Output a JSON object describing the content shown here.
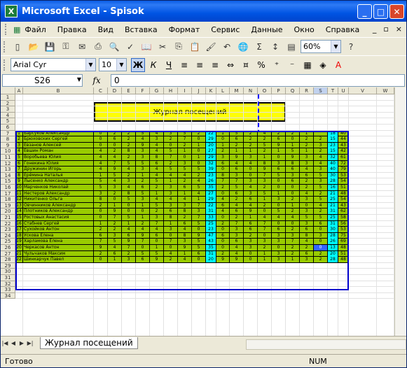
{
  "window": {
    "title": "Microsoft Excel - Spisok",
    "app_icon": "X"
  },
  "menu": {
    "items": [
      "Файл",
      "Правка",
      "Вид",
      "Вставка",
      "Формат",
      "Сервис",
      "Данные",
      "Окно",
      "Справка"
    ]
  },
  "toolbar": {
    "zoom": "60%"
  },
  "format_bar": {
    "font": "Arial Cyr",
    "size": "10",
    "bold": "Ж",
    "italic": "К",
    "underline": "Ч"
  },
  "formula_bar": {
    "cell": "S26",
    "fx": "fx",
    "value": "0"
  },
  "columns": [
    "A",
    "B",
    "C",
    "D",
    "E",
    "F",
    "G",
    "H",
    "I",
    "J",
    "K",
    "L",
    "M",
    "N",
    "O",
    "P",
    "Q",
    "R",
    "S",
    "T",
    "U",
    "V",
    "W"
  ],
  "rows": [
    "1",
    "2",
    "3",
    "4",
    "5",
    "6",
    "7",
    "8",
    "9",
    "10",
    "11",
    "12",
    "13",
    "14",
    "15",
    "16",
    "17",
    "18",
    "19",
    "20",
    "21",
    "22",
    "23",
    "24",
    "25",
    "26",
    "27",
    "28",
    "29",
    "30",
    "31",
    "32",
    "33",
    "34"
  ],
  "sheet": {
    "banner": "Журнал посещений",
    "header_name": "Фамилия, имя",
    "dates_sep": [
      "01 сен",
      "05 сен",
      "08 сен",
      "10 сен",
      "12 сен",
      "15 сен",
      "20 сен",
      "26 сен"
    ],
    "total_sep": "Всего",
    "dates_oct": [
      "02 окт",
      "05 окт",
      "07 окт",
      "13 окт",
      "17 окт",
      "23 окт",
      "29 окт",
      "30 окт"
    ],
    "total_oct": "Всего",
    "total_all": "Итог",
    "students": [
      {
        "n": "1",
        "name": "Барсуков Александр",
        "sep": [
          "0",
          "2",
          "2",
          "5",
          "4",
          "3",
          "5",
          "2"
        ],
        "st": "22",
        "oct": [
          "1",
          "5",
          "2",
          "4",
          "2",
          "2",
          "1",
          ""
        ],
        "ot": "18",
        "t": "40"
      },
      {
        "n": "2",
        "name": "Брюховских Сергей",
        "sep": [
          "0",
          "6",
          "2",
          "4",
          "3",
          "2",
          "7",
          "0"
        ],
        "st": "29",
        "oct": [
          "0",
          "6",
          "2",
          "2",
          "6",
          "0",
          "2",
          "2"
        ],
        "ot": "15",
        "t": "44"
      },
      {
        "n": "3",
        "name": "Евзанов Алексей",
        "sep": [
          "0",
          "0",
          "2",
          "9",
          "4",
          "0",
          "2",
          "1"
        ],
        "st": "20",
        "oct": [
          "1",
          "2",
          "2",
          "5",
          "9",
          "1",
          "2",
          "3"
        ],
        "ot": "23",
        "t": "43"
      },
      {
        "n": "4",
        "name": "Евшин Роман",
        "sep": [
          "4",
          "2",
          "8",
          "3",
          "4",
          "5",
          "1",
          "0"
        ],
        "st": "27",
        "oct": [
          "2",
          "1",
          "1",
          "2",
          "1",
          "5",
          "1",
          "2"
        ],
        "ot": "15",
        "t": "42"
      },
      {
        "n": "5",
        "name": "Воробьева Юлия",
        "sep": [
          "4",
          "4",
          "2",
          "3",
          "8",
          "7",
          "0",
          "1"
        ],
        "st": "29",
        "oct": [
          "3",
          "9",
          "3",
          "1",
          "0",
          "9",
          "3",
          "4"
        ],
        "ot": "32",
        "t": "61"
      },
      {
        "n": "6",
        "name": "Гонекина Юлия",
        "sep": [
          "4",
          "7",
          "5",
          "5",
          "6",
          "2",
          "3",
          "0"
        ],
        "st": "32",
        "oct": [
          "6",
          "4",
          "4",
          "8",
          "3",
          "8",
          "3",
          "4"
        ],
        "ot": "40",
        "t": "72"
      },
      {
        "n": "7",
        "name": "Дружинин Игорь",
        "sep": [
          "4",
          "9",
          "4",
          "3",
          "4",
          "5",
          "5",
          "5"
        ],
        "st": "39",
        "oct": [
          "0",
          "6",
          "0",
          "9",
          "6",
          "6",
          "4",
          "3"
        ],
        "ot": "40",
        "t": "79"
      },
      {
        "n": "8",
        "name": "Ерёмина Наталья",
        "sep": [
          "1",
          "5",
          "2",
          "1",
          "4",
          "4",
          "4",
          "2"
        ],
        "st": "23",
        "oct": [
          "8",
          "3",
          "0",
          "7",
          "5",
          "3",
          "6",
          "5"
        ],
        "ot": "30",
        "t": "53"
      },
      {
        "n": "9",
        "name": "Лысенко Александр",
        "sep": [
          "5",
          "4",
          "3",
          "2",
          "5",
          "1",
          "2",
          "4"
        ],
        "st": "26",
        "oct": [
          "7",
          "7",
          "3",
          "3",
          "0",
          "6",
          "2",
          "3"
        ],
        "ot": "28",
        "t": "54"
      },
      {
        "n": "10",
        "name": "Марченков Николай",
        "sep": [
          "5",
          "3",
          "4",
          "6",
          "2",
          "3",
          "6",
          "5"
        ],
        "st": "35",
        "oct": [
          "2",
          "5",
          "4",
          "2",
          "0",
          "0",
          "2",
          "5"
        ],
        "ot": "16",
        "t": "51"
      },
      {
        "n": "11",
        "name": "Нестеров Александр",
        "sep": [
          "3",
          "2",
          "8",
          "5",
          "1",
          "3",
          "1",
          "4"
        ],
        "st": "27",
        "oct": [
          "0",
          "6",
          "3",
          "5",
          "1",
          "0",
          "4",
          "2"
        ],
        "ot": "21",
        "t": "48"
      },
      {
        "n": "12",
        "name": "Никитенко Ольга",
        "sep": [
          "8",
          "0",
          "5",
          "3",
          "4",
          "4",
          "4",
          "1"
        ],
        "st": "29",
        "oct": [
          "4",
          "2",
          "6",
          "1",
          "3",
          "2",
          "3",
          "5"
        ],
        "ot": "25",
        "t": "54"
      },
      {
        "n": "13",
        "name": "Овчинников Александр",
        "sep": [
          "2",
          "1",
          "0",
          "1",
          "5",
          "3",
          "3",
          "7"
        ],
        "st": "22",
        "oct": [
          "6",
          "4",
          "4",
          "2",
          "0",
          "1",
          "0",
          "4"
        ],
        "ot": "21",
        "t": "43"
      },
      {
        "n": "14",
        "name": "Плотников Александр",
        "sep": [
          "0",
          "9",
          "0",
          "0",
          "2",
          "6",
          "8",
          "3"
        ],
        "st": "31",
        "oct": [
          "4",
          "6",
          "9",
          "0",
          "5",
          "2",
          "3",
          "2"
        ],
        "ot": "31",
        "t": "62"
      },
      {
        "n": "15",
        "name": "Ростовых Анастасия",
        "sep": [
          "0",
          "7",
          "5",
          "1",
          "3",
          "8",
          "2",
          "7"
        ],
        "st": "33",
        "oct": [
          "0",
          "2",
          "1",
          "4",
          "4",
          "4",
          "5",
          "5"
        ],
        "ot": "25",
        "t": "58"
      },
      {
        "n": "16",
        "name": "Стабнев Сергей",
        "sep": [
          "1",
          "2",
          "1",
          "2",
          "7",
          "1",
          "6",
          "5"
        ],
        "st": "25",
        "oct": [
          "2",
          "7",
          "6",
          "7",
          "0",
          "0",
          "3",
          "6"
        ],
        "ot": "31",
        "t": "56"
      },
      {
        "n": "17",
        "name": "Сухойков Антон",
        "sep": [
          "2",
          "2",
          "4",
          "4",
          "4",
          "3",
          "4",
          "0"
        ],
        "st": "23",
        "oct": [
          "0",
          "3",
          "6",
          "7",
          "6",
          "2",
          "6",
          "0"
        ],
        "ot": "30",
        "t": "53"
      },
      {
        "n": "18",
        "name": "Ускова Елена",
        "sep": [
          "6",
          "3",
          "6",
          "9",
          "6",
          "0",
          "8",
          "9"
        ],
        "st": "47",
        "oct": [
          "6",
          "3",
          "2",
          "0",
          "3",
          "3",
          "8",
          "3"
        ],
        "ot": "28",
        "t": "75"
      },
      {
        "n": "19",
        "name": "Харламова Елена",
        "sep": [
          "7",
          "5",
          "9",
          "7",
          "0",
          "7",
          "3",
          "5"
        ],
        "st": "43",
        "oct": [
          "0",
          "6",
          "3",
          "3",
          "3",
          "7",
          "4",
          "0"
        ],
        "ot": "26",
        "t": "69"
      },
      {
        "n": "20",
        "name": "Черкасов Антон",
        "sep": [
          "9",
          "4",
          "7",
          "0",
          "1",
          "0",
          "9",
          "5"
        ],
        "st": "35",
        "oct": [
          "0",
          "4",
          "3",
          "2",
          "0",
          "2",
          "2",
          "0"
        ],
        "ot": "13",
        "t": "48"
      },
      {
        "n": "21",
        "name": "Чульчаков Максим",
        "sep": [
          "2",
          "6",
          "2",
          "5",
          "5",
          "4",
          "1",
          "6"
        ],
        "st": "31",
        "oct": [
          "2",
          "4",
          "0",
          "1",
          "3",
          "2",
          "6",
          "2"
        ],
        "ot": "20",
        "t": "51"
      },
      {
        "n": "22",
        "name": "Шинкарчук Павел",
        "sep": [
          "0",
          "1",
          "3",
          "6",
          "9",
          "2",
          "4",
          "0"
        ],
        "st": "20",
        "oct": [
          "9",
          "9",
          "0",
          "1",
          "3",
          "1",
          "3",
          "2"
        ],
        "ot": "28",
        "t": "48"
      }
    ]
  },
  "tab": {
    "name": "Журнал посещений"
  },
  "status": {
    "left": "Готово",
    "num": "NUM"
  },
  "colors": {
    "green": "#99cc00",
    "orange": "#ff6600",
    "cyan": "#00ffff",
    "yellow": "#ffff00"
  }
}
